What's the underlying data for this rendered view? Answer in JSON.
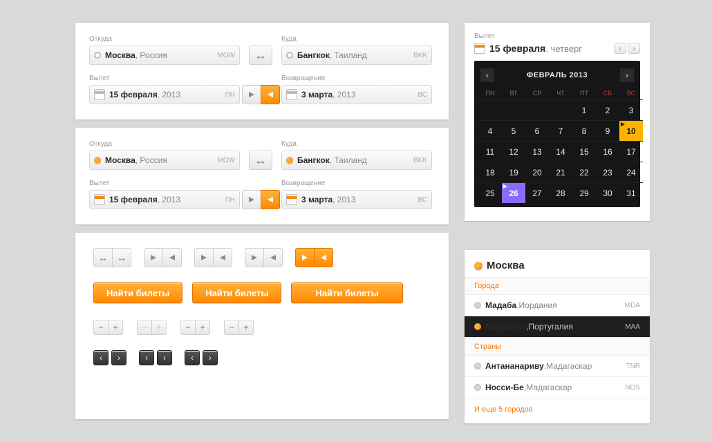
{
  "booking": {
    "from_label": "Откуда",
    "to_label": "Куда",
    "dep_label": "Вылет",
    "ret_label": "Возвращение",
    "from_city": "Москва",
    "from_country": "Россия",
    "from_code": "MOW",
    "to_city": "Бангкок",
    "to_country": "Таиланд",
    "to_code": "BKK",
    "dep_day": "15 февраля",
    "dep_year": "2013",
    "dep_dow": "ПН",
    "ret_day": "3 марта",
    "ret_year": "2013",
    "ret_dow": "ВС"
  },
  "calendar": {
    "label": "Вылет",
    "day": "15 февраля",
    "dow_long": "четверг",
    "month_title": "ФЕВРАЛЬ 2013",
    "dow": [
      "ПН",
      "ВТ",
      "СР",
      "ЧТ",
      "ПТ",
      "СБ",
      "ВС"
    ],
    "lead_blanks": 4,
    "selected_orange": 10,
    "selected_purple": 26,
    "days_in_month": 31
  },
  "cta_label": "Найти билеты",
  "suggest": {
    "query": "Москва",
    "section_cities": "Города",
    "section_countries": "Страны",
    "cities": [
      {
        "name": "Мадаба",
        "country": "Иордания",
        "code": "MDA",
        "active": false
      },
      {
        "name": "Мадалена",
        "country": "Португалия",
        "code": "MAA",
        "active": true
      }
    ],
    "countries": [
      {
        "name": "Антананариву",
        "country": "Мадагаскар",
        "code": "TNR"
      },
      {
        "name": "Носси-Бе",
        "country": "Мадагаскар",
        "code": "NOS"
      }
    ],
    "more": "И еще 5 городов"
  }
}
